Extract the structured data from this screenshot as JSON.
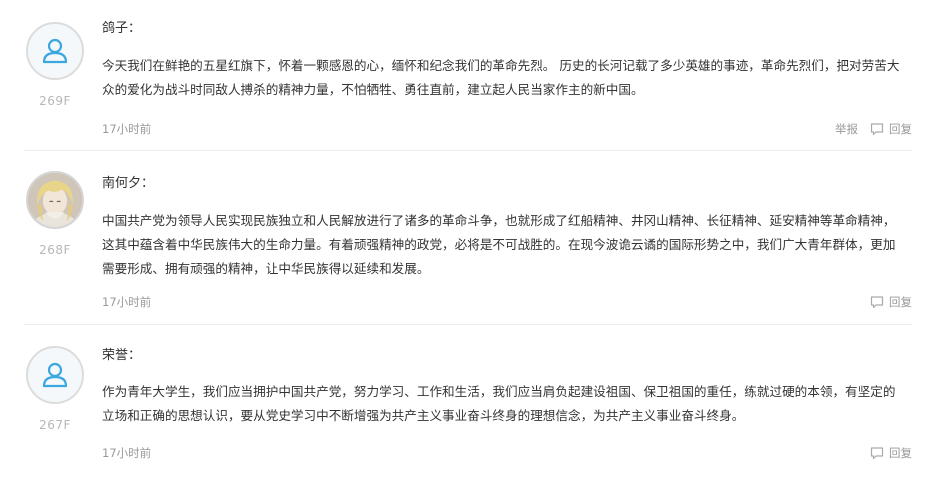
{
  "comments": [
    {
      "username": "鸽子：",
      "avatar": "default-user-icon",
      "floor": "269F",
      "text": "今天我们在鲜艳的五星红旗下，怀着一颗感恩的心，缅怀和纪念我们的革命先烈。 历史的长河记载了多少英雄的事迹，革命先烈们，把对劳苦大众的爱化为战斗时同敌人搏杀的精神力量，不怕牺牲、勇往直前，建立起人民当家作主的新中国。",
      "time": "17小时前",
      "report_label": "举报",
      "reply_label": "回复"
    },
    {
      "username": "南何夕：",
      "avatar": "user-photo",
      "floor": "268F",
      "text": "中国共产党为领导人民实现民族独立和人民解放进行了诸多的革命斗争，也就形成了红船精神、井冈山精神、长征精神、延安精神等革命精神，这其中蕴含着中华民族伟大的生命力量。有着顽强精神的政党，必将是不可战胜的。在现今波诡云谲的国际形势之中，我们广大青年群体，更加需要形成、拥有顽强的精神，让中华民族得以延续和发展。",
      "time": "17小时前",
      "report_label": "",
      "reply_label": "回复"
    },
    {
      "username": "荣誉：",
      "avatar": "default-user-icon",
      "floor": "267F",
      "text": "作为青年大学生，我们应当拥护中国共产党，努力学习、工作和生活，我们应当肩负起建设祖国、保卫祖国的重任，练就过硬的本领，有坚定的立场和正确的思想认识，要从党史学习中不断增强为共产主义事业奋斗终身的理想信念，为共产主义事业奋斗终身。",
      "time": "17小时前",
      "report_label": "",
      "reply_label": "回复"
    }
  ],
  "colors": {
    "avatar_icon": "#3ba7e0",
    "text": "#333333",
    "muted": "#999999",
    "floor": "#b7b7b7",
    "divider": "#ececec"
  }
}
